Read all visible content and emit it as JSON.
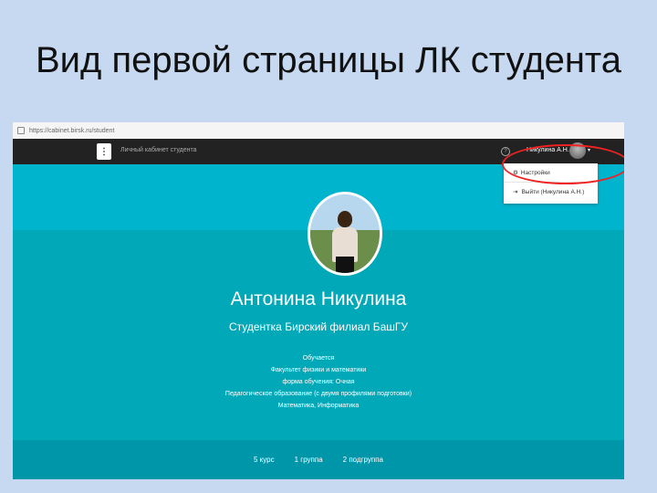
{
  "slide": {
    "title": "Вид первой страницы ЛК студента"
  },
  "browser": {
    "url": "https://cabinet.birsk.ru/student"
  },
  "navbar": {
    "menu_label": "⋮",
    "title": "Личный кабинет студента",
    "help_icon": "question-icon",
    "user_name": "Никулина А.Н.",
    "caret": "▾"
  },
  "dropdown": {
    "items": [
      {
        "label": "Настройки",
        "icon": "gear-icon"
      },
      {
        "label": "Выйти (Никулина А.Н.)",
        "icon": "logout-icon"
      }
    ]
  },
  "profile": {
    "name": "Антонина Никулина",
    "subtitle": "Студентка Бирский филиал БашГУ",
    "info": [
      "Обучается",
      "Факультет физики и математики",
      "форма обучения: Очная",
      "Педагогическое образование (с двумя профилями подготовки)",
      "Математика, Информатика"
    ]
  },
  "footer": {
    "course": "5 курс",
    "group": "1 группа",
    "subgroup": "2 подгруппа"
  },
  "colors": {
    "accent": "#00b4cd",
    "navbar": "#222222",
    "highlight": "#e22222",
    "background": "#c6d9f1"
  }
}
